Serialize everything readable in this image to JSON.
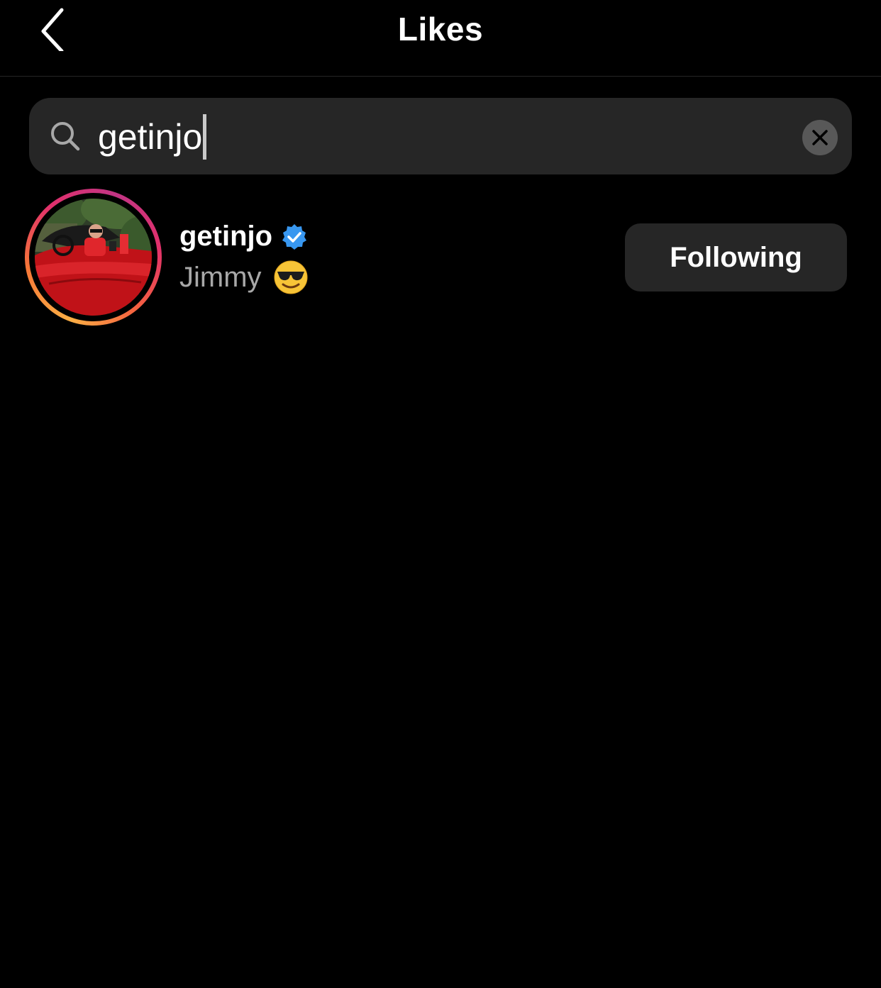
{
  "header": {
    "title": "Likes",
    "back_icon": "chevron-left-icon"
  },
  "search": {
    "value": "getinjo",
    "icon": "search-icon",
    "clear_icon": "clear-icon"
  },
  "results": [
    {
      "username": "getinjo",
      "verified": true,
      "full_name": "Jimmy",
      "name_emoji": "sunglasses-emoji",
      "has_story_ring": true,
      "action_label": "Following"
    }
  ],
  "colors": {
    "background": "#000000",
    "surface": "#262626",
    "text_primary": "#ffffff",
    "text_secondary": "#a8a8a8",
    "verified": "#3897f0",
    "story_ring": [
      "#fcaf45",
      "#f77737",
      "#e1306c",
      "#c13584"
    ]
  }
}
